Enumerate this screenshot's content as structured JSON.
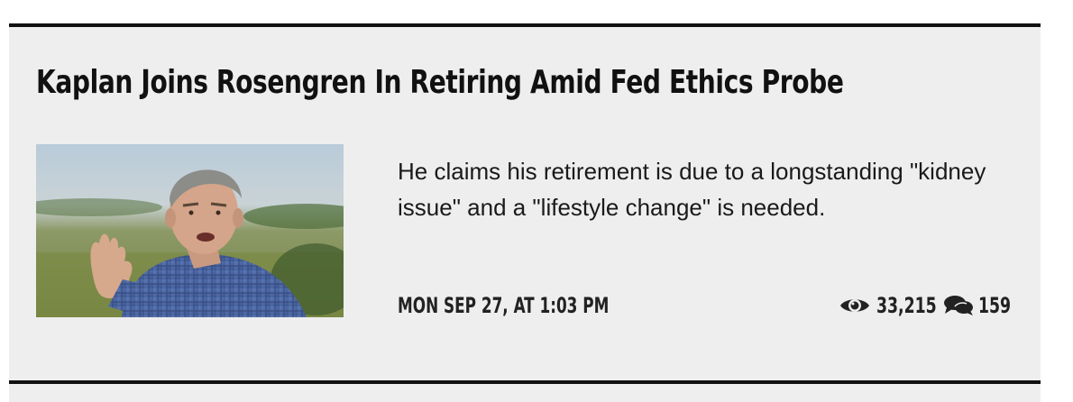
{
  "article": {
    "headline": "Kaplan Joins Rosengren In Retiring Amid Fed Ethics Probe",
    "teaser": "He claims his retirement is due to a longstanding \"kidney issue\" and a \"lifestyle change\" is needed.",
    "timestamp": "MON SEP 27, AT 1:03 PM",
    "views": "33,215",
    "comments": "159",
    "icons": {
      "views": "eye-icon",
      "comments": "comments-icon"
    }
  },
  "colors": {
    "card_background": "#eeeeee",
    "divider": "#111111",
    "text": "#111111"
  }
}
